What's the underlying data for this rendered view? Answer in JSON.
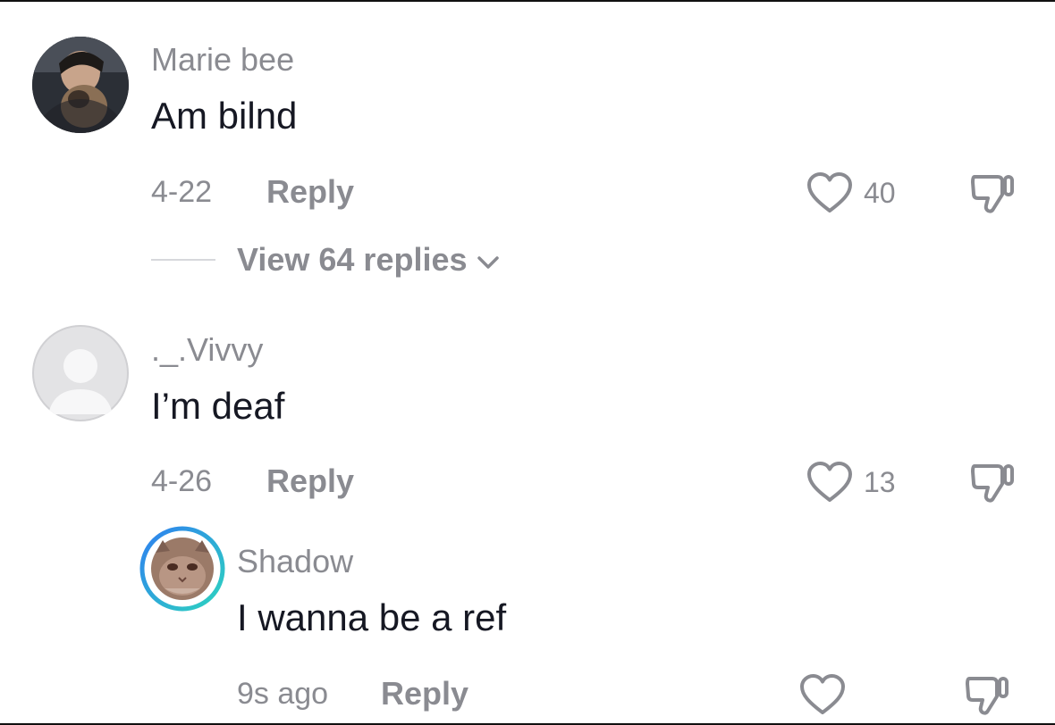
{
  "comments": [
    {
      "username": "Marie bee",
      "text": "Am bilnd",
      "date": "4-22",
      "reply_label": "Reply",
      "likes": "40",
      "view_replies": "View 64 replies"
    },
    {
      "username": "._.Vivvy",
      "text": "I’m deaf",
      "date": "4-26",
      "reply_label": "Reply",
      "likes": "13"
    }
  ],
  "reply": {
    "username": "Shadow",
    "text": "I wanna be a ref",
    "date": "9s ago",
    "reply_label": "Reply",
    "likes": ""
  },
  "colors": {
    "secondary_text": "#8a8b91",
    "primary_text": "#161823",
    "story_ring_start": "#2dd4bf",
    "story_ring_end": "#2f7ff0"
  },
  "icons": [
    "heart-outline-icon",
    "thumbs-down-icon",
    "chevron-down-icon",
    "default-avatar-icon"
  ]
}
